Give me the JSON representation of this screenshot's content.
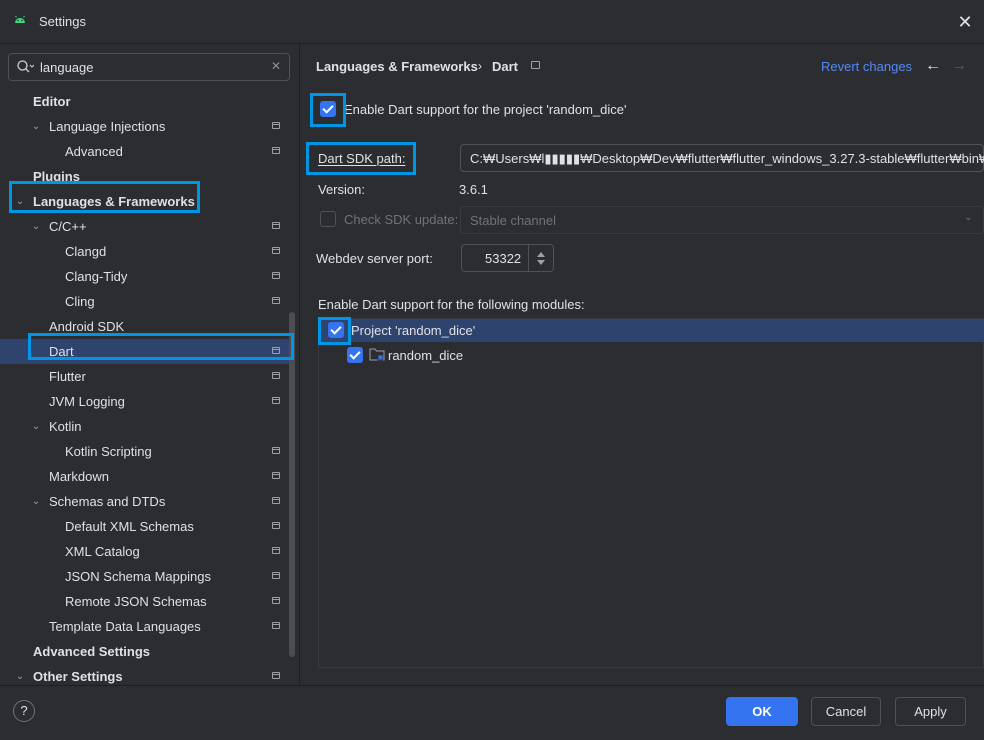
{
  "window": {
    "title": "Settings",
    "app_icon": "android-icon",
    "close_icon": "close-icon"
  },
  "search": {
    "value": "language",
    "search_icon": "search-icon",
    "clear_icon": "clear-icon"
  },
  "tree": [
    {
      "label": "Editor",
      "bold": true,
      "indent": 0,
      "chevron": ""
    },
    {
      "label": "Language Injections",
      "indent": 1,
      "chevron": "down",
      "project_icon": true
    },
    {
      "label": "Advanced",
      "indent": 2,
      "chevron": "",
      "project_icon": true
    },
    {
      "label": "Plugins",
      "bold": true,
      "indent": 0,
      "chevron": ""
    },
    {
      "label": "Languages & Frameworks",
      "bold": true,
      "indent": 0,
      "chevron": "down"
    },
    {
      "label": "C/C++",
      "indent": 1,
      "chevron": "down",
      "project_icon": true
    },
    {
      "label": "Clangd",
      "indent": 2,
      "chevron": "",
      "project_icon": true
    },
    {
      "label": "Clang-Tidy",
      "indent": 2,
      "chevron": "",
      "project_icon": true
    },
    {
      "label": "Cling",
      "indent": 2,
      "chevron": "",
      "project_icon": true
    },
    {
      "label": "Android SDK",
      "indent": 1,
      "chevron": ""
    },
    {
      "label": "Dart",
      "indent": 1,
      "chevron": "",
      "project_icon": true,
      "selected": true
    },
    {
      "label": "Flutter",
      "indent": 1,
      "chevron": "",
      "project_icon": true
    },
    {
      "label": "JVM Logging",
      "indent": 1,
      "chevron": "",
      "project_icon": true
    },
    {
      "label": "Kotlin",
      "indent": 1,
      "chevron": "down"
    },
    {
      "label": "Kotlin Scripting",
      "indent": 2,
      "chevron": "",
      "project_icon": true
    },
    {
      "label": "Markdown",
      "indent": 1,
      "chevron": "",
      "project_icon": true
    },
    {
      "label": "Schemas and DTDs",
      "indent": 1,
      "chevron": "down",
      "project_icon": true
    },
    {
      "label": "Default XML Schemas",
      "indent": 2,
      "chevron": "",
      "project_icon": true
    },
    {
      "label": "XML Catalog",
      "indent": 2,
      "chevron": "",
      "project_icon": true
    },
    {
      "label": "JSON Schema Mappings",
      "indent": 2,
      "chevron": "",
      "project_icon": true
    },
    {
      "label": "Remote JSON Schemas",
      "indent": 2,
      "chevron": "",
      "project_icon": true
    },
    {
      "label": "Template Data Languages",
      "indent": 1,
      "chevron": "",
      "project_icon": true
    },
    {
      "label": "Advanced Settings",
      "bold": true,
      "indent": 0,
      "chevron": ""
    },
    {
      "label": "Other Settings",
      "bold": true,
      "indent": 0,
      "chevron": "down",
      "project_icon": true
    }
  ],
  "breadcrumb": {
    "parent": "Languages & Frameworks",
    "separator": "›",
    "current": "Dart"
  },
  "header_actions": {
    "revert": "Revert changes",
    "back_icon": "arrow-left-icon",
    "forward_icon": "arrow-right-icon"
  },
  "dart": {
    "enable_label": "Enable Dart support for the project 'random_dice'",
    "enable_checked": true,
    "sdk_label": "Dart SDK path:",
    "sdk_path": "C:₩Users₩l▮▮▮▮▮₩Desktop₩Dev₩flutter₩flutter_windows_3.27.3-stable₩flutter₩bin₩cache₩dart-sdk",
    "version_label": "Version:",
    "version_value": "3.6.1",
    "check_update_label": "Check SDK update:",
    "check_update_checked": false,
    "channel_value": "Stable channel",
    "webdev_label": "Webdev server port:",
    "webdev_port": "53322",
    "modules_label": "Enable Dart support for the following modules:",
    "modules": [
      {
        "label": "Project 'random_dice'",
        "checked": true
      },
      {
        "label": "random_dice",
        "checked": true,
        "icon": "module-folder-icon"
      }
    ]
  },
  "footer": {
    "help": "?",
    "ok": "OK",
    "cancel": "Cancel",
    "apply": "Apply"
  },
  "colors": {
    "background": "#2b2d30",
    "selection": "#2e436e",
    "accent": "#3574f0",
    "link": "#548af7",
    "highlight_box": "#0096e6"
  }
}
